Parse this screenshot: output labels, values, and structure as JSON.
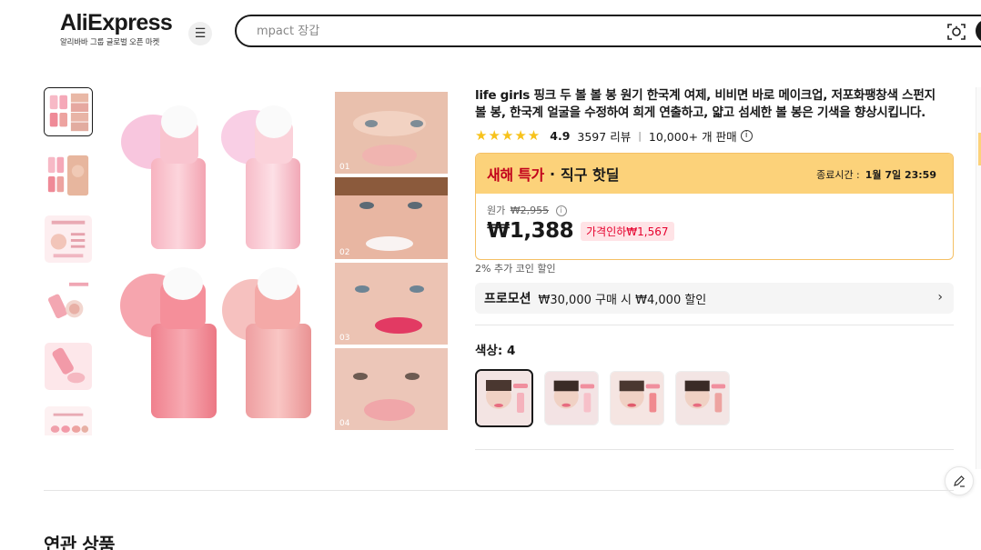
{
  "header": {
    "logo_text": "AliExpress",
    "logo_subtitle": "알리바바 그룹 글로벌 오픈 마켓",
    "menu_icon": "hamburger-icon",
    "search": {
      "placeholder": "mpact 장갑",
      "value": ""
    }
  },
  "gallery": {
    "thumbnail_count": 6,
    "selected_index": 0,
    "main_image_labels": [
      "01",
      "02",
      "03",
      "04"
    ]
  },
  "product": {
    "title": "life girls 핑크 두 볼 볼 봉 원기 한국계 여제, 비비면 바로 메이크업, 저포화팽창색 스펀지 볼 봉, 한국계 얼굴을 수정하여 희게 연출하고, 얇고 섬세한 볼 봉은 기색을 향상시킵니다.",
    "stars": "★★★★★",
    "rating": "4.9",
    "reviews": "3597 리뷰",
    "separator": "|",
    "sold": "10,000+ 개 판매"
  },
  "deal": {
    "name": "새해 특가",
    "dot": "·",
    "sub": "직구 핫딜",
    "end_label": "종료시간 :",
    "end_time": "1월 7일 23:59",
    "original_label": "원가",
    "original_price": "₩2,955",
    "price": "₩1,388",
    "discount": "가격인하₩1,567"
  },
  "coin_text": "2% 추가 코인 할인",
  "promotion": {
    "tag": "프로모션",
    "text": "₩30,000 구매 시 ₩4,000 할인"
  },
  "color": {
    "label": "색상: 4",
    "selected_index": 0,
    "option_count": 4
  },
  "related_title": "연관 상품",
  "colors": {
    "accent_red": "#e6002d",
    "deal_yellow": "#fcd27a",
    "star_yellow": "#f7c21b",
    "deal_red": "#c2001b"
  }
}
